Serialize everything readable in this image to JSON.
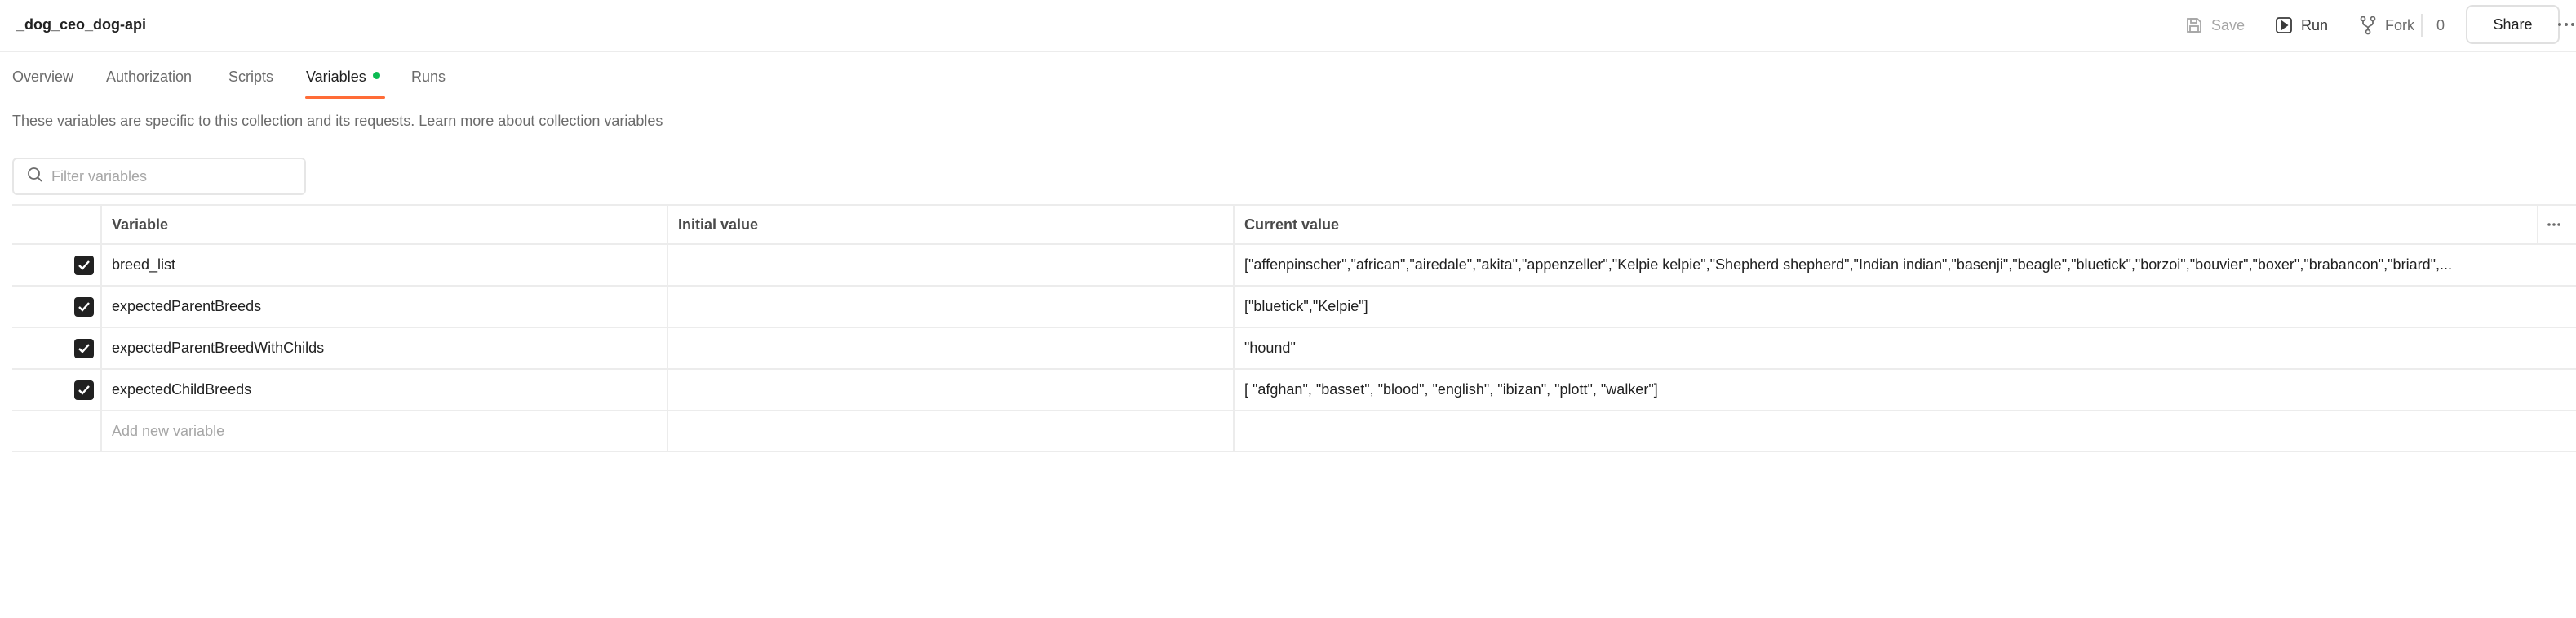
{
  "header": {
    "title": "_dog_ceo_dog-api",
    "save_label": "Save",
    "run_label": "Run",
    "fork_label": "Fork",
    "fork_count": "0",
    "share_label": "Share"
  },
  "tabs": [
    {
      "label": "Overview",
      "active": false
    },
    {
      "label": "Authorization",
      "active": false
    },
    {
      "label": "Scripts",
      "active": false
    },
    {
      "label": "Variables",
      "active": true
    },
    {
      "label": "Runs",
      "active": false
    }
  ],
  "description": {
    "text": "These variables are specific to this collection and its requests. Learn more about ",
    "link": "collection variables"
  },
  "filter": {
    "placeholder": "Filter variables"
  },
  "table": {
    "columns": [
      "Variable",
      "Initial value",
      "Current value"
    ],
    "rows": [
      {
        "checked": true,
        "variable": "breed_list",
        "initial": "",
        "current": "[\"affenpinscher\",\"african\",\"airedale\",\"akita\",\"appenzeller\",\"Kelpie kelpie\",\"Shepherd shepherd\",\"Indian indian\",\"basenji\",\"beagle\",\"bluetick\",\"borzoi\",\"bouvier\",\"boxer\",\"brabancon\",\"briard\",..."
      },
      {
        "checked": true,
        "variable": "expectedParentBreeds",
        "initial": "",
        "current": "[\"bluetick\",\"Kelpie\"]"
      },
      {
        "checked": true,
        "variable": "expectedParentBreedWithChilds",
        "initial": "",
        "current": "\"hound\""
      },
      {
        "checked": true,
        "variable": "expectedChildBreeds",
        "initial": "",
        "current": "[ \"afghan\", \"basset\", \"blood\", \"english\", \"ibizan\", \"plott\", \"walker\"]"
      }
    ],
    "add_placeholder": "Add new variable"
  },
  "colors": {
    "accent": "#ff6c37",
    "status_dot": "#0cbb52",
    "checkbox": "#212121"
  }
}
